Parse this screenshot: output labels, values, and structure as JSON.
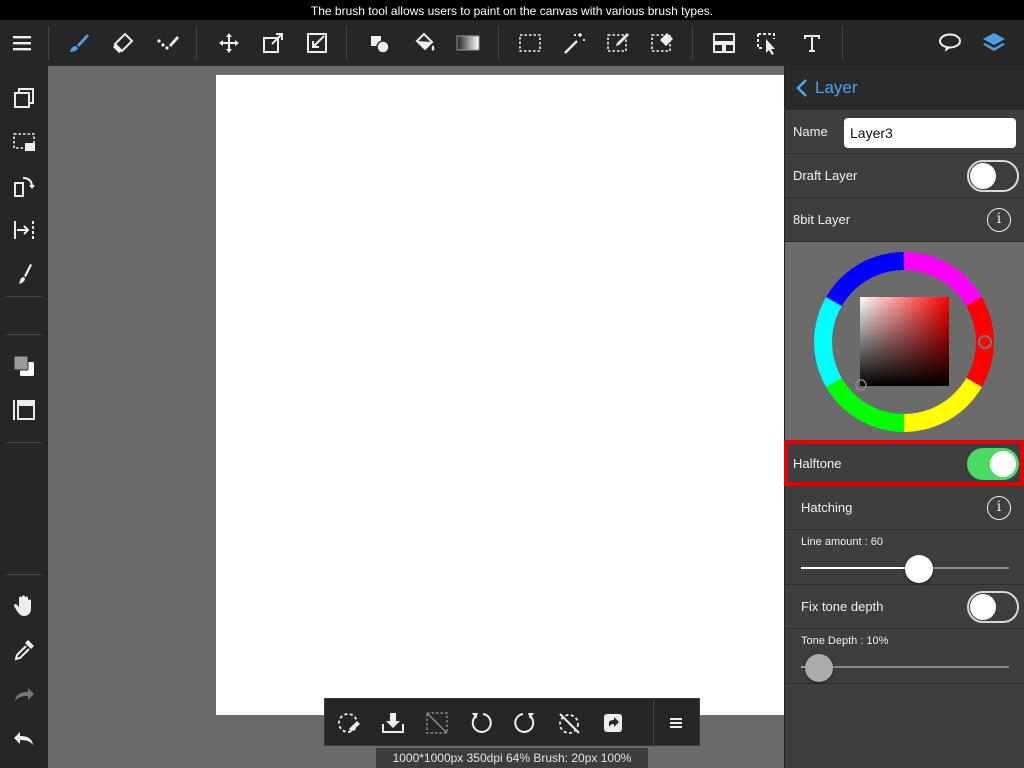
{
  "hint": "The brush tool allows users to paint on the canvas with various brush types.",
  "toolbar": {
    "items": [
      "menu-icon",
      "brush-icon",
      "eraser-icon",
      "snap-icon",
      "move-icon",
      "transform-icon",
      "resize-icon",
      "fill-shape-icon",
      "bucket-icon",
      "gradient-icon",
      "select-rect-icon",
      "magic-wand-icon",
      "select-pen-icon",
      "select-eraser-icon",
      "frame-divider-icon",
      "operation-icon",
      "text-icon",
      "speech-bubble-icon",
      "layers-icon"
    ],
    "accent": "#4a9fe8"
  },
  "left_bar": {
    "items": [
      "layer-copy-icon",
      "selection-icon",
      "rotate-icon",
      "flip-icon",
      "brush-size-icon",
      "color-swatch-icon",
      "ruler-icon",
      "hand-icon",
      "eyedropper-icon",
      "redo-icon",
      "undo-icon"
    ]
  },
  "panel": {
    "back_label": "Layer",
    "name_label": "Name",
    "name_value": "Layer3",
    "draft_label": "Draft Layer",
    "draft_on": false,
    "bit8_label": "8bit Layer",
    "halftone_label": "Halftone",
    "halftone_on": true,
    "hatching_label": "Hatching",
    "line_amount_label": "Line amount : 60",
    "line_amount_value": 60,
    "fix_tone_label": "Fix tone depth",
    "fix_tone_on": false,
    "tone_depth_label": "Tone Depth : 10%",
    "tone_depth_value": 10
  },
  "quick_bar": {
    "items": [
      "deselect-icon",
      "import-icon",
      "clear-icon",
      "rotate-left-icon",
      "rotate-right-icon",
      "reset-rotation-icon",
      "share-icon",
      "more-menu-icon"
    ]
  },
  "status": "1000*1000px 350dpi 64% Brush: 20px 100%"
}
